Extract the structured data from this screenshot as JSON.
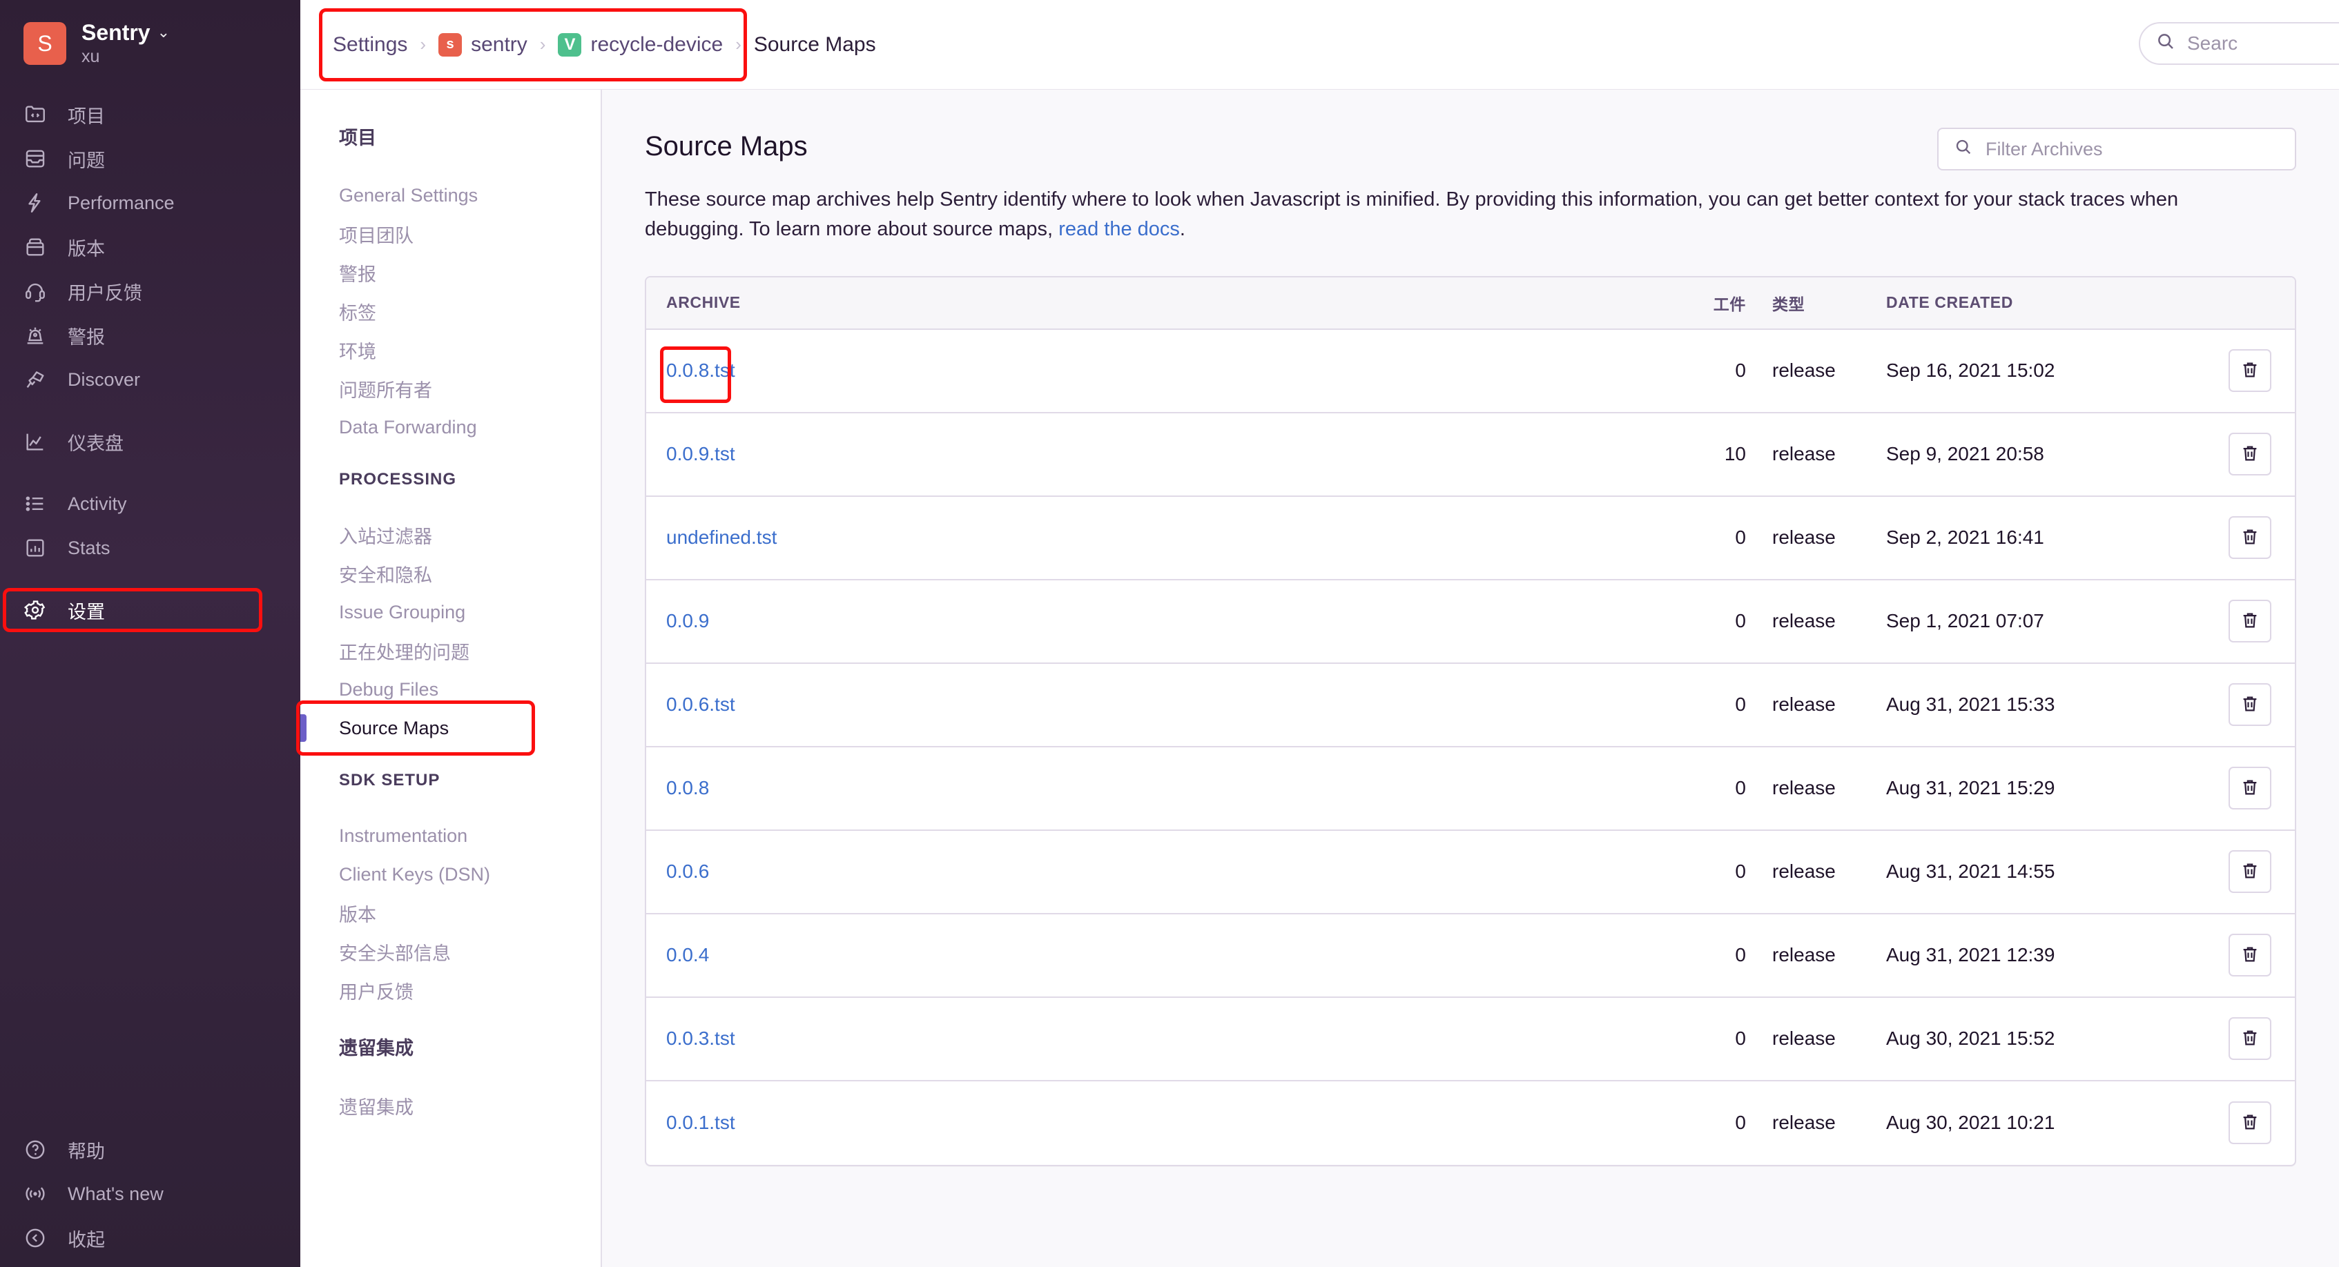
{
  "org_sidebar": {
    "avatar_letter": "S",
    "org_name": "Sentry",
    "org_sub": "xu",
    "caret": "⌄",
    "items": [
      {
        "label": "项目",
        "icon": "projects-icon"
      },
      {
        "label": "问题",
        "icon": "issues-icon"
      },
      {
        "label": "Performance",
        "icon": "performance-icon"
      },
      {
        "label": "版本",
        "icon": "releases-icon"
      },
      {
        "label": "用户反馈",
        "icon": "user-feedback-icon"
      },
      {
        "label": "警报",
        "icon": "alerts-icon"
      },
      {
        "label": "Discover",
        "icon": "discover-icon"
      },
      {
        "label": "仪表盘",
        "icon": "dashboards-icon"
      },
      {
        "label": "Activity",
        "icon": "activity-icon"
      },
      {
        "label": "Stats",
        "icon": "stats-icon"
      },
      {
        "label": "设置",
        "icon": "settings-gear-icon"
      }
    ],
    "bottom_items": [
      {
        "label": "帮助",
        "icon": "help-icon"
      },
      {
        "label": "What's new",
        "icon": "broadcast-icon"
      },
      {
        "label": "收起",
        "icon": "collapse-icon"
      }
    ]
  },
  "topbar": {
    "breadcrumbs": [
      {
        "label": "Settings",
        "badge": null
      },
      {
        "label": "sentry",
        "badge": "s",
        "badge_color": "#e8604c"
      },
      {
        "label": "recycle-device",
        "badge": "V",
        "badge_color": "#4ec08d"
      },
      {
        "label": "Source Maps",
        "badge": null
      }
    ],
    "separator": "›",
    "search_placeholder": "Searc"
  },
  "settings_nav": {
    "groups": [
      {
        "heading": "项目",
        "items": [
          "General Settings",
          "项目团队",
          "警报",
          "标签",
          "环境",
          "问题所有者",
          "Data Forwarding"
        ]
      },
      {
        "heading": "PROCESSING",
        "items": [
          "入站过滤器",
          "安全和隐私",
          "Issue Grouping",
          "正在处理的问题",
          "Debug Files",
          "Source Maps"
        ]
      },
      {
        "heading": "SDK SETUP",
        "items": [
          "Instrumentation",
          "Client Keys (DSN)",
          "版本",
          "安全头部信息",
          "用户反馈"
        ]
      },
      {
        "heading": "遗留集成",
        "items": [
          "遗留集成"
        ]
      }
    ],
    "active_item": "Source Maps"
  },
  "main": {
    "title": "Source Maps",
    "description_part1": "These source map archives help Sentry identify where to look when Javascript is minified. By providing this information, you can get better context for your stack traces when debugging. To learn more about source maps, ",
    "description_link": "read the docs",
    "description_part2": ".",
    "filter_placeholder": "Filter Archives",
    "table": {
      "columns": [
        "ARCHIVE",
        "工件",
        "类型",
        "DATE CREATED"
      ],
      "rows": [
        {
          "archive": "0.0.8.tst",
          "artifacts": "0",
          "type": "release",
          "date": "Sep 16, 2021 15:02"
        },
        {
          "archive": "0.0.9.tst",
          "artifacts": "10",
          "type": "release",
          "date": "Sep 9, 2021 20:58"
        },
        {
          "archive": "undefined.tst",
          "artifacts": "0",
          "type": "release",
          "date": "Sep 2, 2021 16:41"
        },
        {
          "archive": "0.0.9",
          "artifacts": "0",
          "type": "release",
          "date": "Sep 1, 2021 07:07"
        },
        {
          "archive": "0.0.6.tst",
          "artifacts": "0",
          "type": "release",
          "date": "Aug 31, 2021 15:33"
        },
        {
          "archive": "0.0.8",
          "artifacts": "0",
          "type": "release",
          "date": "Aug 31, 2021 15:29"
        },
        {
          "archive": "0.0.6",
          "artifacts": "0",
          "type": "release",
          "date": "Aug 31, 2021 14:55"
        },
        {
          "archive": "0.0.4",
          "artifacts": "0",
          "type": "release",
          "date": "Aug 31, 2021 12:39"
        },
        {
          "archive": "0.0.3.tst",
          "artifacts": "0",
          "type": "release",
          "date": "Aug 30, 2021 15:52"
        },
        {
          "archive": "0.0.1.tst",
          "artifacts": "0",
          "type": "release",
          "date": "Aug 30, 2021 10:21"
        }
      ]
    }
  },
  "colors": {
    "accent": "#6c5fc7",
    "link": "#3b6ecc",
    "highlight": "#fb0f0f",
    "org_avatar": "#e8604c",
    "project_badge": "#4ec08d"
  }
}
